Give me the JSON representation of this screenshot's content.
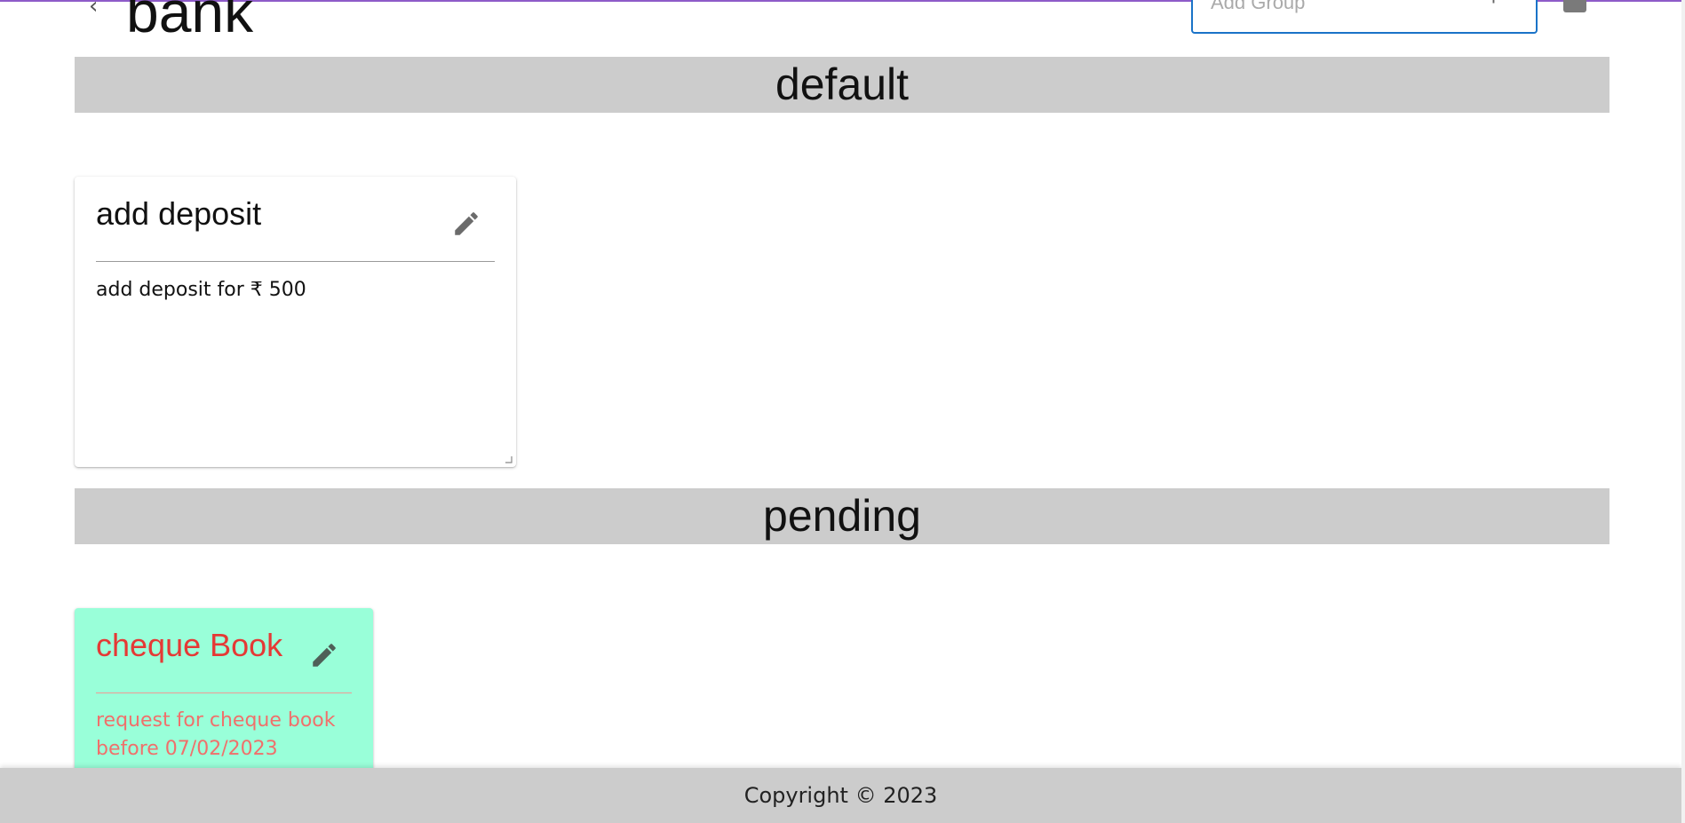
{
  "header": {
    "title": "bank",
    "back_icon": "chevron-left-icon",
    "add_group_placeholder": "Add Group",
    "add_icon": "plus-icon"
  },
  "sections": [
    {
      "name": "default",
      "cards": [
        {
          "title": "add deposit",
          "body": "add deposit for ₹ 500",
          "color": "#ffffff",
          "edit_icon": "pencil-icon"
        }
      ]
    },
    {
      "name": "pending",
      "cards": [
        {
          "title": "cheque Book",
          "body": "request for cheque book before 07/02/2023",
          "color": "#99ffd9",
          "text_color": "#e53935",
          "edit_icon": "pencil-icon"
        }
      ]
    }
  ],
  "footer": {
    "copyright": "Copyright © 2023"
  },
  "colors": {
    "accent": "#1a73c8",
    "section_bg": "#cccccc",
    "top_line": "#8e5bc8"
  }
}
